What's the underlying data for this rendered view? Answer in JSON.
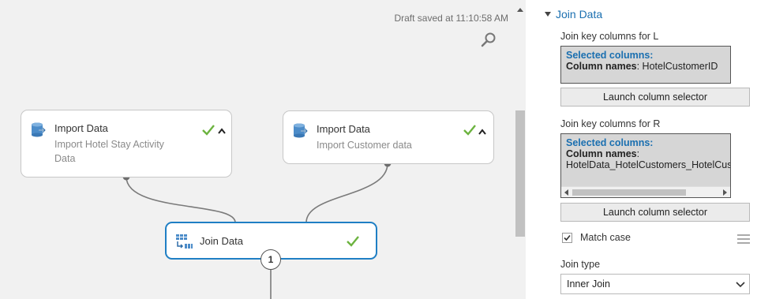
{
  "canvas": {
    "draft_status": "Draft saved at 11:10:58 AM",
    "search_icon": "magnifier-icon",
    "modules": [
      {
        "title": "Import Data",
        "subtitle_line1": "Import Hotel Stay Activity",
        "subtitle_line2": "Data",
        "status": "completed",
        "icon": "import-data-icon"
      },
      {
        "title": "Import Data",
        "subtitle_line1": "Import Customer data",
        "status": "completed",
        "icon": "import-data-icon"
      },
      {
        "title": "Join Data",
        "status": "completed",
        "icon": "join-data-icon",
        "selected": true,
        "output_port": "1"
      }
    ]
  },
  "panel": {
    "title": "Join Data",
    "left_keys": {
      "label": "Join key columns for L",
      "heading": "Selected columns:",
      "names_label": "Column names",
      "names_value": ": HotelCustomerID",
      "button": "Launch column selector"
    },
    "right_keys": {
      "label": "Join key columns for R",
      "heading": "Selected columns:",
      "names_label": "Column names",
      "names_suffix": ":",
      "names_value": "HotelData_HotelCustomers_HotelCus",
      "button": "Launch column selector"
    },
    "match_case": {
      "label": "Match case",
      "checked": true
    },
    "join_type": {
      "label": "Join type",
      "value": "Inner Join"
    }
  },
  "colors": {
    "accent": "#1a6fb0",
    "selected_border": "#1f7fc4",
    "success": "#6cb33f"
  }
}
